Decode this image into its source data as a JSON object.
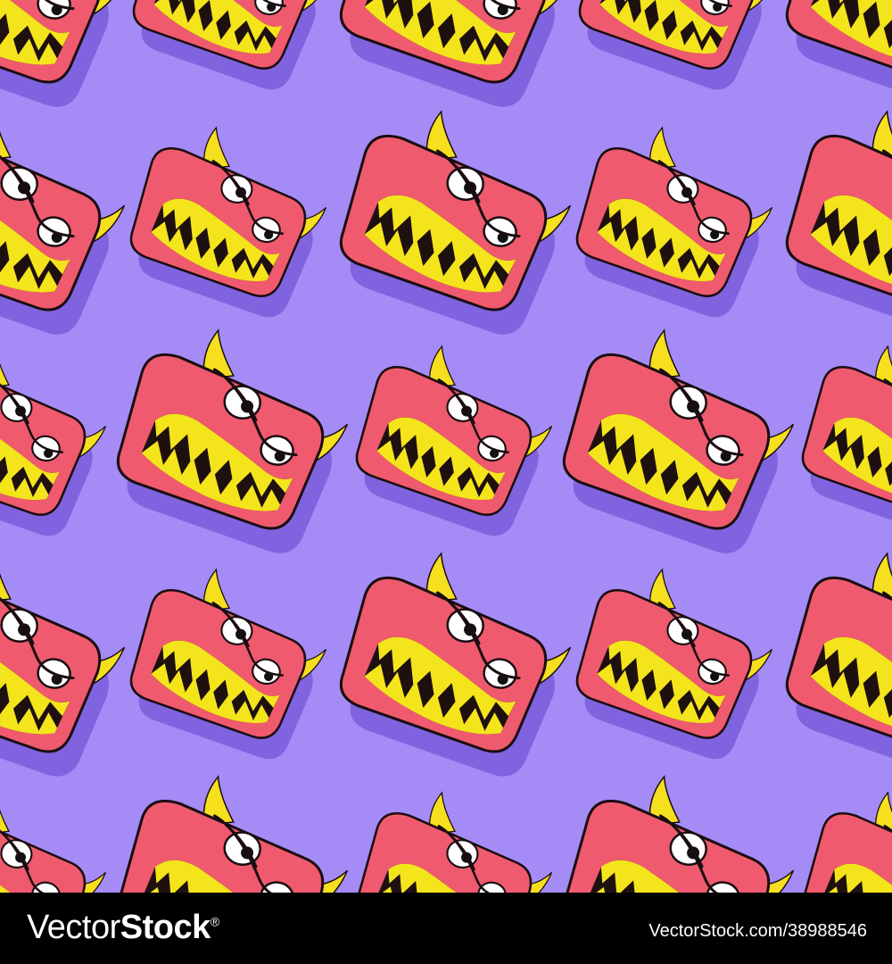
{
  "pattern": {
    "background_color": "#a58bf6",
    "shadow_color": "#7f63df",
    "face_color": "#f05a6e",
    "outline_color": "#1a0d12",
    "horn_color": "#f5df1f",
    "teeth_color": "#f4e41c",
    "mouth_color": "#1f1010",
    "eye_color": "#ffffff",
    "pupil_color": "#111111",
    "motif_icon": "devil-monster-face-icon"
  },
  "footer": {
    "brand_part1": "Vector",
    "brand_part2": "Stock",
    "brand_reg": "®",
    "stock_ref": "VectorStock.com/38988546"
  }
}
